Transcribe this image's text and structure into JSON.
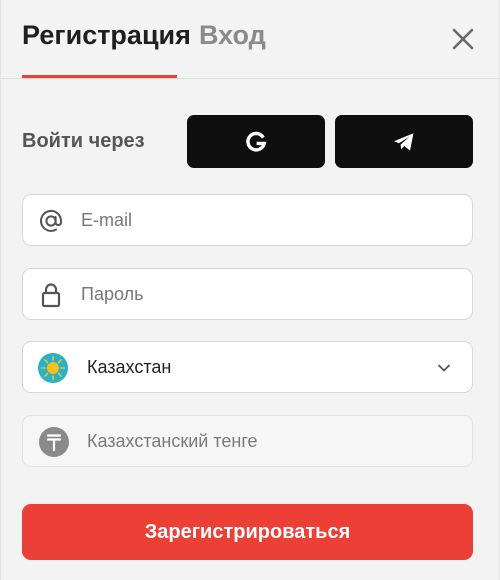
{
  "tabs": {
    "register": "Регистрация",
    "login": "Вход"
  },
  "social": {
    "label": "Войти через",
    "google_icon": "google-g-icon",
    "telegram_icon": "telegram-plane-icon"
  },
  "form": {
    "email": {
      "placeholder": "E-mail",
      "value": "",
      "icon": "at-sign-icon"
    },
    "password": {
      "placeholder": "Пароль",
      "value": "",
      "icon": "lock-icon"
    },
    "country": {
      "value": "Казахстан",
      "icon": "kazakhstan-flag-icon"
    },
    "currency": {
      "value": "Казахстанский тенге",
      "icon": "tenge-icon"
    }
  },
  "submit_label": "Зарегистрироваться",
  "colors": {
    "accent": "#ec3f35",
    "tab_underline": "#e8432f",
    "social_button": "#0f0f10",
    "flag_blue": "#2ab0c8",
    "flag_sun": "#f4c21e"
  }
}
